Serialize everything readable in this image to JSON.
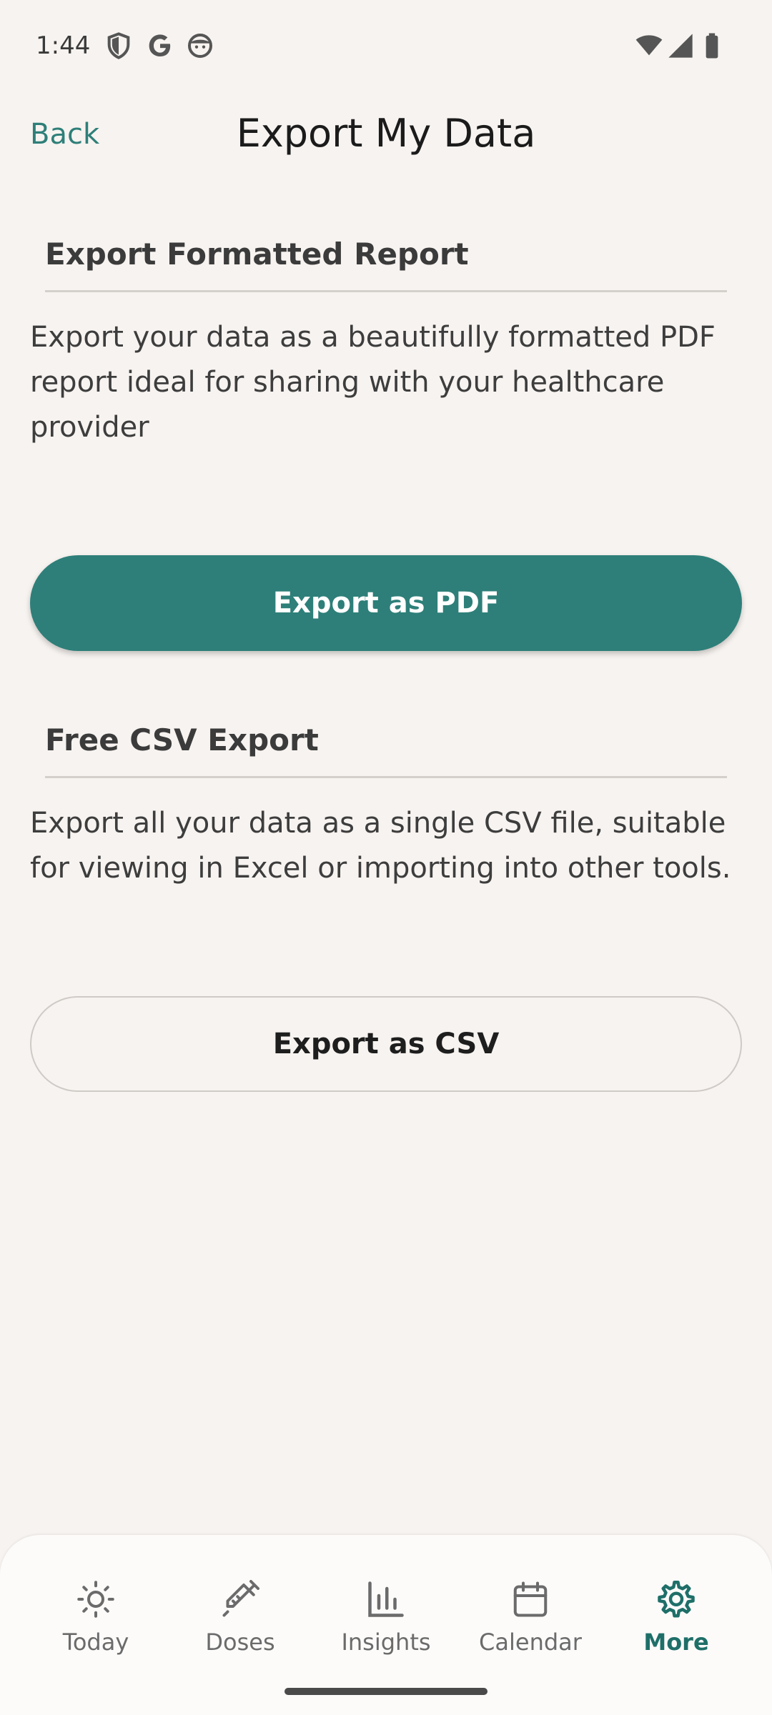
{
  "status_bar": {
    "time": "1:44",
    "icons": [
      "shield-icon",
      "google-icon",
      "face-icon",
      "wifi-icon",
      "signal-icon",
      "battery-icon"
    ]
  },
  "header": {
    "back_label": "Back",
    "title": "Export My Data"
  },
  "sections": [
    {
      "heading": "Export Formatted Report",
      "description": "Export your data as a beautifully formatted PDF report ideal for sharing with your healthcare provider",
      "button_label": "Export as PDF"
    },
    {
      "heading": "Free CSV Export",
      "description": "Export all your data as a single CSV file, suitable for viewing in Excel or importing into other tools.",
      "button_label": "Export as CSV"
    }
  ],
  "bottom_nav": {
    "items": [
      {
        "label": "Today",
        "icon": "sun-icon"
      },
      {
        "label": "Doses",
        "icon": "syringe-icon"
      },
      {
        "label": "Insights",
        "icon": "bar-chart-icon"
      },
      {
        "label": "Calendar",
        "icon": "calendar-icon"
      },
      {
        "label": "More",
        "icon": "gear-icon"
      }
    ],
    "active": "More"
  },
  "colors": {
    "accent": "#2e7f79",
    "background": "#f7f3f0",
    "nav_background": "#fcfbfa"
  }
}
